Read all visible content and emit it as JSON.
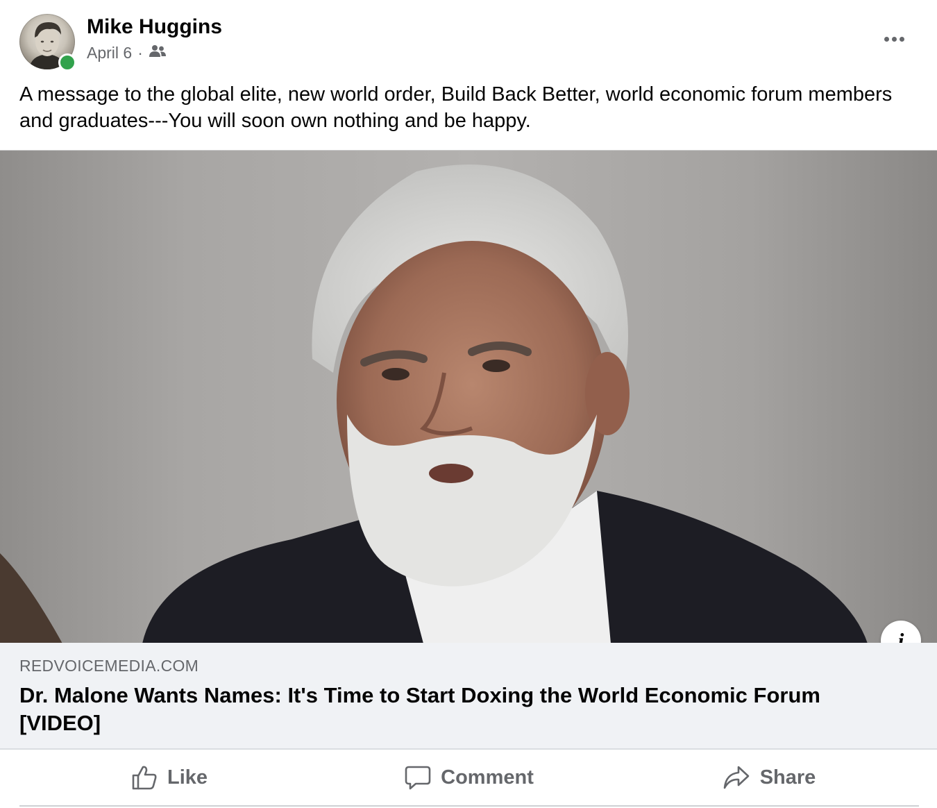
{
  "post": {
    "author": "Mike Huggins",
    "date": "April 6",
    "separator": "·",
    "audience_icon": "friends-icon",
    "text": "A message to the global elite, new world order, Build Back Better, world economic forum members and graduates---You will soon own nothing and be happy."
  },
  "link": {
    "domain": "REDVOICEMEDIA.COM",
    "title": "Dr. Malone Wants Names: It's Time to Start Doxing the World Economic Forum [VIDEO]",
    "info_icon": "i"
  },
  "actions": {
    "like": "Like",
    "comment": "Comment",
    "share": "Share"
  },
  "colors": {
    "online": "#31a24c",
    "secondary_text": "#65676b",
    "link_background": "#f0f2f5"
  }
}
